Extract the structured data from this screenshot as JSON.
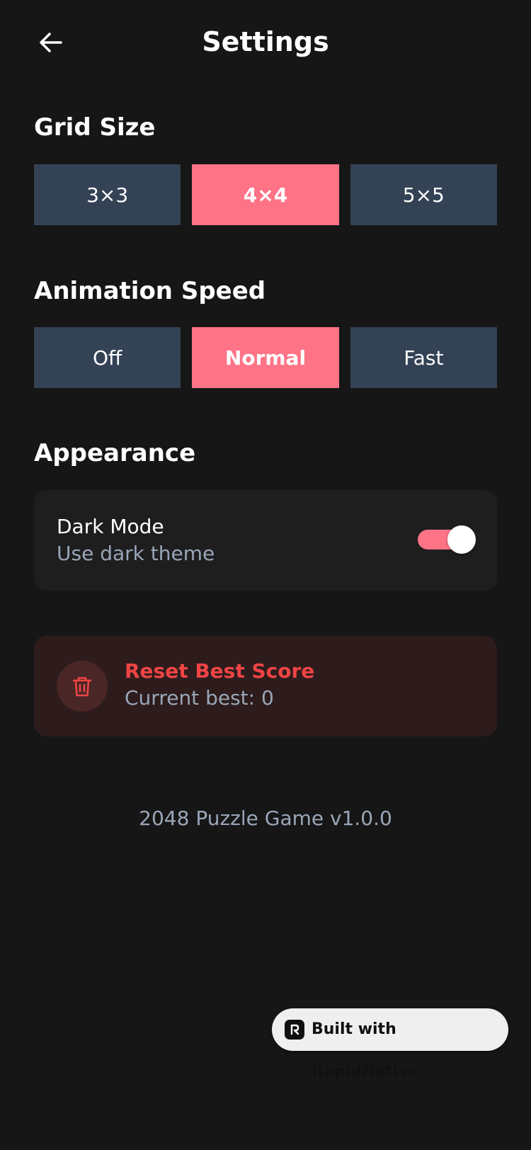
{
  "header": {
    "title": "Settings",
    "back_icon": "arrow-left-icon"
  },
  "grid_size": {
    "title": "Grid Size",
    "options": [
      "3×3",
      "4×4",
      "5×5"
    ],
    "selected": "4×4"
  },
  "animation_speed": {
    "title": "Animation Speed",
    "options": [
      "Off",
      "Normal",
      "Fast"
    ],
    "selected": "Normal"
  },
  "appearance": {
    "title": "Appearance",
    "dark_mode": {
      "label": "Dark Mode",
      "description": "Use dark theme",
      "enabled": true
    }
  },
  "reset": {
    "icon": "trash-icon",
    "title": "Reset Best Score",
    "subtitle": "Current best: 0"
  },
  "footer": {
    "version": "2048 Puzzle Game v1.0.0"
  },
  "badge": {
    "label": "Built with RapidNative"
  },
  "colors": {
    "background": "#161616",
    "accent": "#ff7387",
    "segment": "#344255",
    "danger": "#ef4444",
    "muted_text": "#9aa6b8"
  }
}
